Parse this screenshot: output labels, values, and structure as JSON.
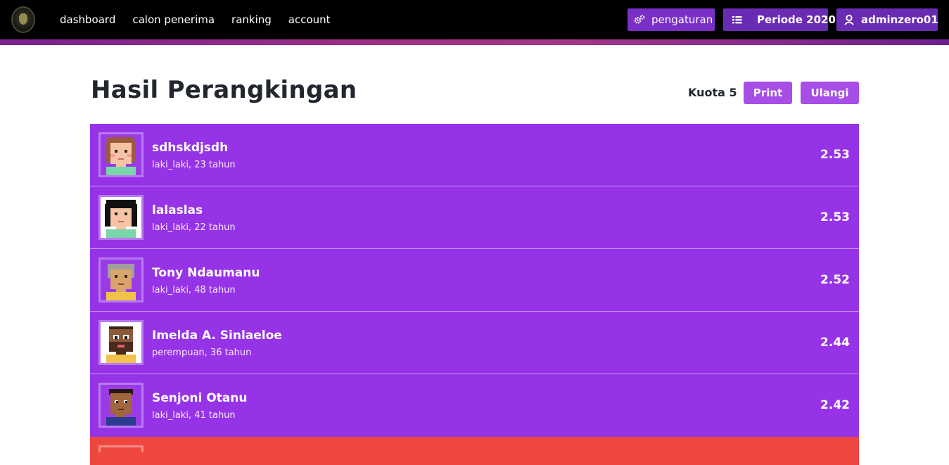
{
  "nav": {
    "links": [
      "dashboard",
      "calon penerima",
      "ranking",
      "account"
    ],
    "settings_label": "pengaturan",
    "periode_label": "Periode 2020",
    "user_label": "adminzero01"
  },
  "header": {
    "title": "Hasil Perangkingan",
    "kuota": "Kuota 5",
    "print_label": "Print",
    "ulangi_label": "Ulangi"
  },
  "ranking": [
    {
      "name": "sdhskdjsdh",
      "detail": "laki_laki, 23 tahun",
      "score": "2.53",
      "avatar": "avatar-light-brown-hair"
    },
    {
      "name": "lalaslas",
      "detail": "laki_laki, 22 tahun",
      "score": "2.53",
      "avatar": "avatar-black-hair"
    },
    {
      "name": "Tony Ndaumanu",
      "detail": "laki_laki, 48 tahun",
      "score": "2.52",
      "avatar": "avatar-grey-hair"
    },
    {
      "name": "Imelda A. Sinlaeloe",
      "detail": "perempuan, 36 tahun",
      "score": "2.44",
      "avatar": "avatar-beard"
    },
    {
      "name": "Senjoni Otanu",
      "detail": "laki_laki, 41 tahun",
      "score": "2.42",
      "avatar": "avatar-dark-skin"
    }
  ],
  "colors": {
    "navbar": "#000000",
    "accent": "#9733e6",
    "button": "#a64ee6",
    "next_row": "#ee4740"
  }
}
